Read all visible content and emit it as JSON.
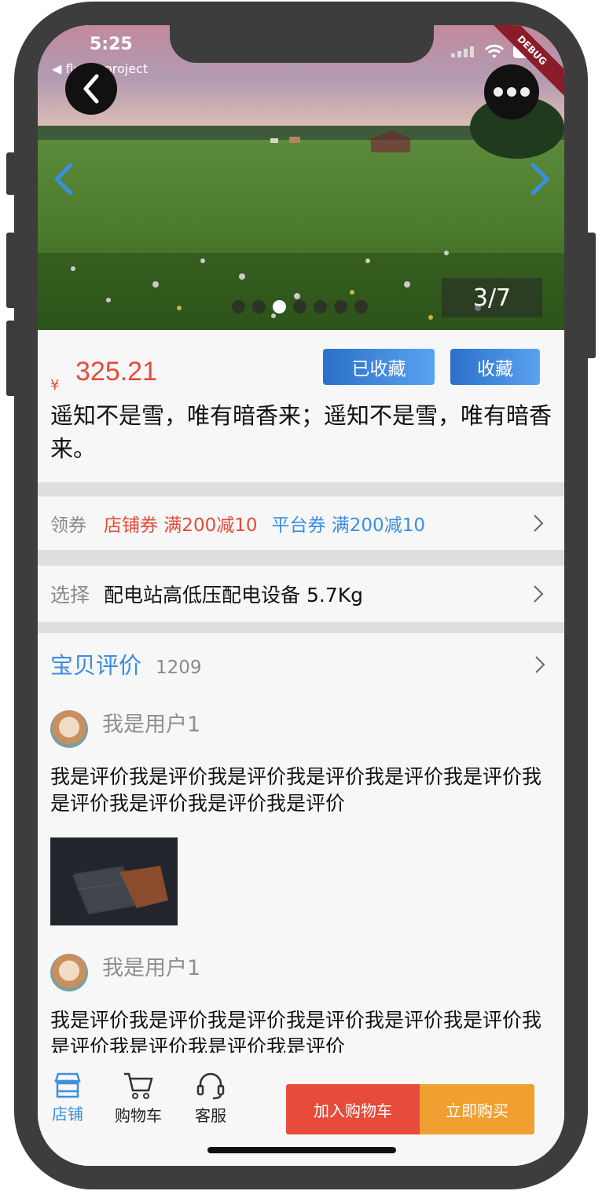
{
  "status": {
    "time": "5:25",
    "back_app": "◀ flutterproject",
    "debug": "DEBUG"
  },
  "gallery": {
    "counter": "3/7",
    "dot_count": 7,
    "active_dot": 2
  },
  "product": {
    "currency": "¥",
    "price": "325.21",
    "favorited_label": "已收藏",
    "favorite_label": "收藏",
    "title": "遥知不是雪，唯有暗香来；遥知不是雪，唯有暗香来。"
  },
  "coupons": {
    "label": "领券",
    "store_coupon": "店铺券 满200减10",
    "platform_coupon": "平台券 满200减10"
  },
  "selection": {
    "label": "选择",
    "value": "配电站高低压配电设备 5.7Kg"
  },
  "reviews": {
    "title": "宝贝评价",
    "count": "1209",
    "items": [
      {
        "user": "我是用户1",
        "text": "我是评价我是评价我是评价我是评价我是评价我是评价我是评价我是评价我是评价我是评价"
      },
      {
        "user": "我是用户1",
        "text": "我是评价我是评价我是评价我是评价我是评价我是评价我是评价我是评价我是评价我是评价"
      }
    ]
  },
  "bottom": {
    "store": "店铺",
    "cart": "购物车",
    "service": "客服",
    "add_to_cart": "加入购物车",
    "buy_now": "立即购买"
  },
  "colors": {
    "price_red": "#e64b3b",
    "accent_blue": "#3a8fe0",
    "buy_orange": "#f0a030"
  }
}
